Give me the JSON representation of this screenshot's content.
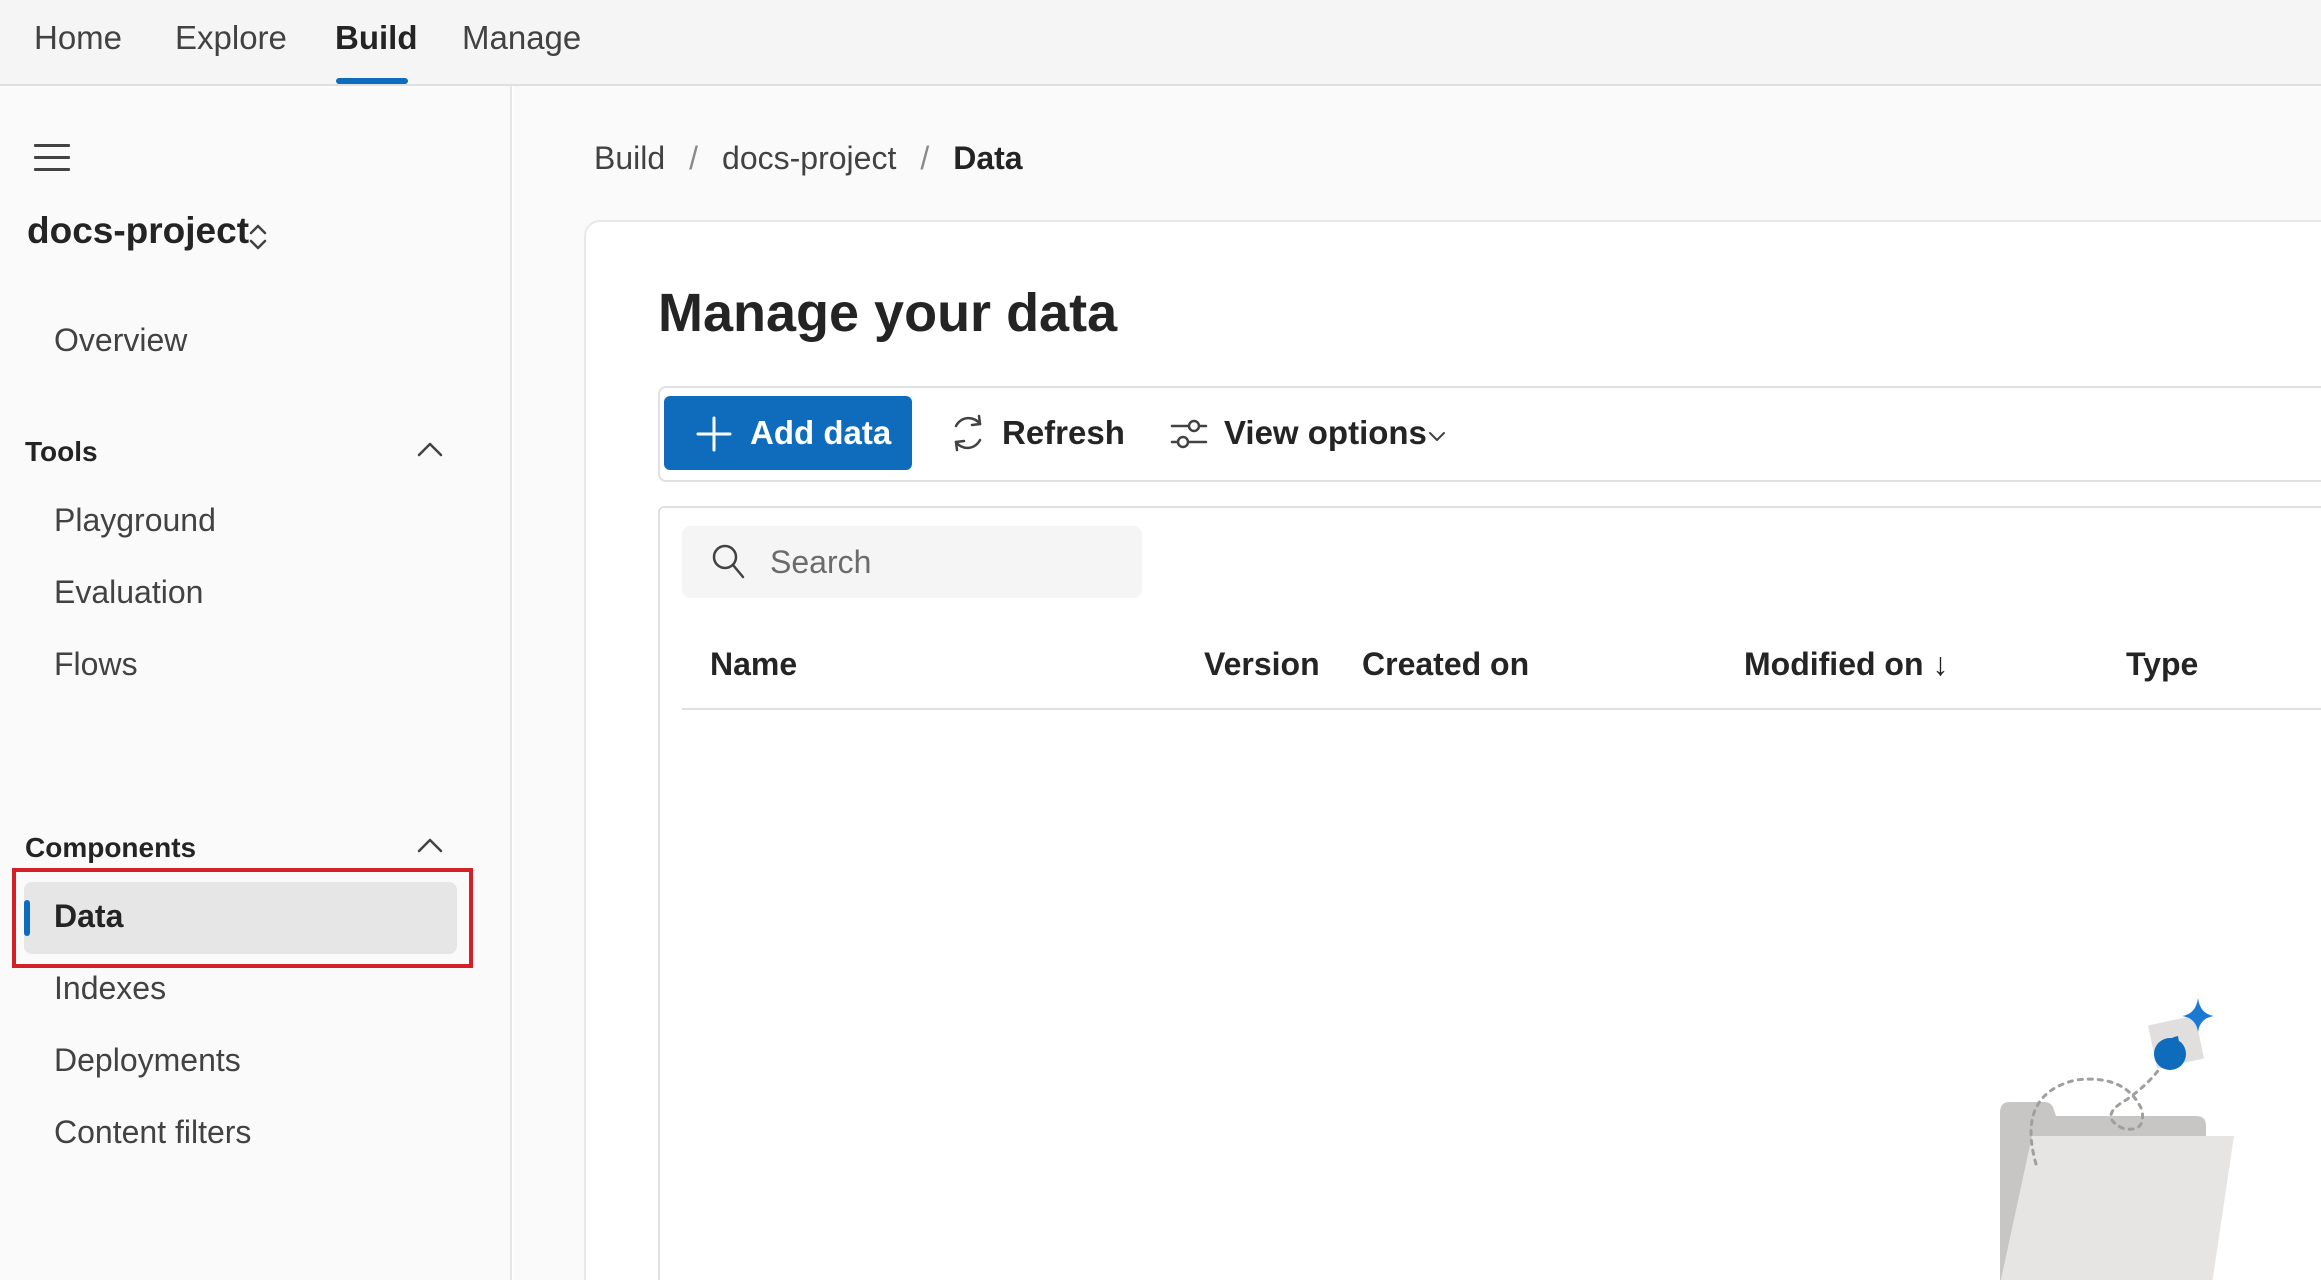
{
  "topnav": {
    "tabs": [
      {
        "label": "Home"
      },
      {
        "label": "Explore"
      },
      {
        "label": "Build"
      },
      {
        "label": "Manage"
      }
    ]
  },
  "sidebar": {
    "project_name": "docs-project",
    "overview": "Overview",
    "sections": {
      "tools": {
        "title": "Tools",
        "items": [
          "Playground",
          "Evaluation",
          "Flows"
        ]
      },
      "components": {
        "title": "Components",
        "items": [
          "Data",
          "Indexes",
          "Deployments",
          "Content filters"
        ]
      }
    },
    "selected_item": "Data"
  },
  "breadcrumb": [
    "Build",
    "docs-project",
    "Data"
  ],
  "main": {
    "title": "Manage your data",
    "toolbar": {
      "add_label": "Add data",
      "refresh_label": "Refresh",
      "view_options_label": "View options"
    },
    "search": {
      "placeholder": "Search"
    },
    "columns": [
      "Name",
      "Version",
      "Created on",
      "Modified on ↓",
      "Type"
    ]
  },
  "colors": {
    "accent": "#0f6cbd",
    "highlight": "#d42027"
  },
  "icons": [
    "hamburger-menu-icon",
    "up-down-chevron-icon",
    "chevron-up-icon",
    "plus-icon",
    "refresh-icon",
    "sliders-icon",
    "chevron-down-icon",
    "search-icon",
    "empty-folder-illustration"
  ]
}
